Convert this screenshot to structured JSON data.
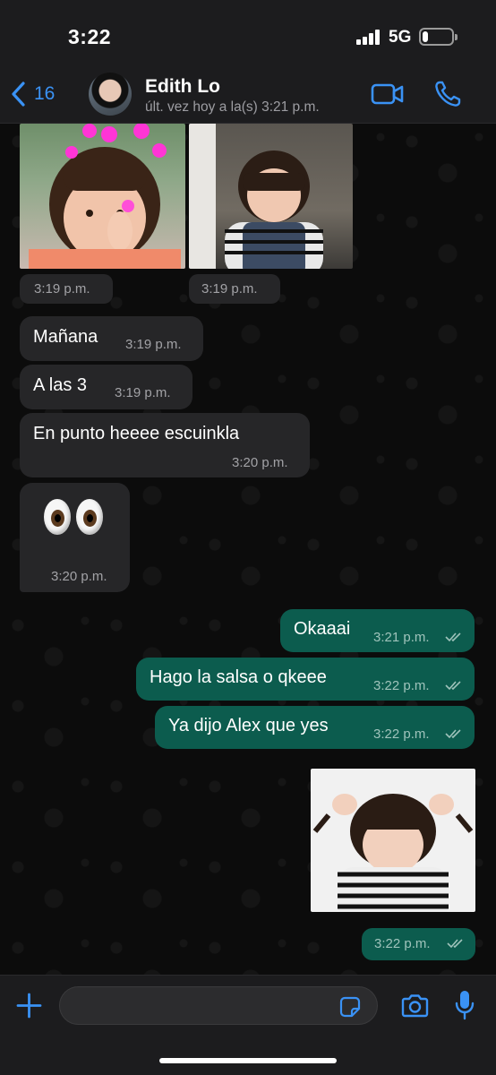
{
  "status_bar": {
    "time": "3:22",
    "network": "5G",
    "battery_level": 0.2
  },
  "header": {
    "back_count": "16",
    "contact_name": "Edith Lo",
    "contact_status": "últ. vez hoy a la(s) 3:21 p.m.",
    "icons": [
      "chevron-left-icon",
      "video-call-icon",
      "phone-icon"
    ]
  },
  "messages": {
    "photo1": {
      "time": "3:19 p.m."
    },
    "photo2": {
      "time": "3:19 p.m."
    },
    "m1": {
      "text": "Mañana",
      "time": "3:19 p.m."
    },
    "m2": {
      "text": "A las 3",
      "time": "3:19 p.m."
    },
    "m3": {
      "text": "En punto heeee escuinkla",
      "time": "3:20 p.m."
    },
    "m4": {
      "emoji": "eyes",
      "time": "3:20 p.m."
    },
    "m5": {
      "text": "Okaaai",
      "time": "3:21 p.m."
    },
    "m6": {
      "text": "Hago la salsa o qkeee",
      "time": "3:22 p.m."
    },
    "m7": {
      "text": "Ya dijo Alex que yes",
      "time": "3:22 p.m."
    },
    "photo3": {
      "time": "3:22 p.m."
    }
  },
  "colors": {
    "accent": "#3a92f5",
    "incoming_bubble": "#262628",
    "outgoing_bubble": "#0c5c4e",
    "header_bg": "#1c1c1e"
  },
  "input_bar": {
    "icons": [
      "plus-icon",
      "sticker-icon",
      "camera-icon",
      "microphone-icon"
    ]
  }
}
